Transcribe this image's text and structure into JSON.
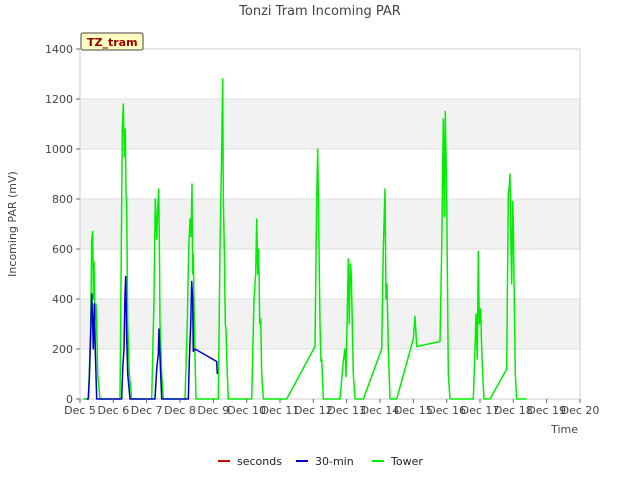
{
  "chart_data": {
    "type": "line",
    "title": "Tonzi Tram Incoming PAR",
    "xlabel": "Time",
    "ylabel": "Incoming PAR (mV)",
    "badge": "TZ_tram",
    "xlim": [
      5,
      20
    ],
    "ylim": [
      0,
      1400
    ],
    "x_ticks": [
      5,
      6,
      7,
      8,
      9,
      10,
      11,
      12,
      13,
      14,
      15,
      16,
      17,
      18,
      19,
      20
    ],
    "x_tick_labels": [
      "Dec 5",
      "Dec 6",
      "Dec 7",
      "Dec 8",
      "Dec 9",
      "Dec 10",
      "Dec 11",
      "Dec 12",
      "Dec 13",
      "Dec 14",
      "Dec 15",
      "Dec 16",
      "Dec 17",
      "Dec 18",
      "Dec 19",
      "Dec 20"
    ],
    "y_ticks": [
      0,
      200,
      400,
      600,
      800,
      1000,
      1200,
      1400
    ],
    "y_tick_labels": [
      "0",
      "200",
      "400",
      "600",
      "800",
      "1000",
      "1200",
      "1400"
    ],
    "grid": true,
    "legend_placement": "bottom",
    "series": [
      {
        "name": "seconds",
        "color": "#cc0000",
        "points": []
      },
      {
        "name": "30-min",
        "color": "#0000cc",
        "points": [
          [
            5.2,
            0
          ],
          [
            5.25,
            0
          ],
          [
            5.28,
            80
          ],
          [
            5.32,
            260
          ],
          [
            5.35,
            420
          ],
          [
            5.38,
            300
          ],
          [
            5.4,
            200
          ],
          [
            5.43,
            380
          ],
          [
            5.46,
            190
          ],
          [
            5.5,
            0
          ],
          [
            5.55,
            0
          ],
          [
            6.2,
            0
          ],
          [
            6.25,
            0
          ],
          [
            6.28,
            120
          ],
          [
            6.32,
            200
          ],
          [
            6.35,
            420
          ],
          [
            6.37,
            490
          ],
          [
            6.4,
            250
          ],
          [
            6.43,
            100
          ],
          [
            6.5,
            0
          ],
          [
            6.55,
            0
          ],
          [
            7.2,
            0
          ],
          [
            7.25,
            0
          ],
          [
            7.3,
            120
          ],
          [
            7.35,
            180
          ],
          [
            7.37,
            280
          ],
          [
            7.39,
            200
          ],
          [
            7.45,
            0
          ],
          [
            7.5,
            0
          ],
          [
            8.2,
            0
          ],
          [
            8.25,
            0
          ],
          [
            8.28,
            150
          ],
          [
            8.32,
            300
          ],
          [
            8.35,
            470
          ],
          [
            8.38,
            400
          ],
          [
            8.4,
            190
          ],
          [
            8.45,
            200
          ],
          [
            9.1,
            150
          ],
          [
            9.12,
            100
          ]
        ]
      },
      {
        "name": "Tower",
        "color": "#00ee00",
        "points": [
          [
            5.1,
            0
          ],
          [
            5.2,
            0
          ],
          [
            5.25,
            0
          ],
          [
            5.28,
            100
          ],
          [
            5.32,
            300
          ],
          [
            5.35,
            640
          ],
          [
            5.38,
            670
          ],
          [
            5.4,
            400
          ],
          [
            5.42,
            550
          ],
          [
            5.45,
            320
          ],
          [
            5.48,
            380
          ],
          [
            5.5,
            300
          ],
          [
            5.53,
            100
          ],
          [
            5.6,
            0
          ],
          [
            6.0,
            0
          ],
          [
            6.15,
            0
          ],
          [
            6.2,
            0
          ],
          [
            6.24,
            600
          ],
          [
            6.27,
            1080
          ],
          [
            6.3,
            1180
          ],
          [
            6.33,
            970
          ],
          [
            6.36,
            1080
          ],
          [
            6.38,
            820
          ],
          [
            6.4,
            780
          ],
          [
            6.43,
            300
          ],
          [
            6.48,
            100
          ],
          [
            6.55,
            0
          ],
          [
            7.0,
            0
          ],
          [
            7.15,
            0
          ],
          [
            7.22,
            400
          ],
          [
            7.26,
            800
          ],
          [
            7.3,
            640
          ],
          [
            7.33,
            760
          ],
          [
            7.36,
            840
          ],
          [
            7.38,
            650
          ],
          [
            7.4,
            300
          ],
          [
            7.45,
            100
          ],
          [
            7.5,
            0
          ],
          [
            8.0,
            0
          ],
          [
            8.15,
            0
          ],
          [
            8.22,
            300
          ],
          [
            8.26,
            600
          ],
          [
            8.3,
            720
          ],
          [
            8.33,
            650
          ],
          [
            8.36,
            860
          ],
          [
            8.38,
            500
          ],
          [
            8.4,
            580
          ],
          [
            8.43,
            300
          ],
          [
            8.48,
            0
          ],
          [
            8.55,
            0
          ],
          [
            9.1,
            0
          ],
          [
            9.15,
            0
          ],
          [
            9.2,
            600
          ],
          [
            9.25,
            1000
          ],
          [
            9.28,
            1280
          ],
          [
            9.3,
            800
          ],
          [
            9.33,
            600
          ],
          [
            9.36,
            300
          ],
          [
            9.38,
            280
          ],
          [
            9.42,
            100
          ],
          [
            9.45,
            0
          ],
          [
            9.6,
            0
          ],
          [
            10.0,
            0
          ],
          [
            10.15,
            0
          ],
          [
            10.22,
            400
          ],
          [
            10.27,
            500
          ],
          [
            10.3,
            720
          ],
          [
            10.33,
            500
          ],
          [
            10.36,
            600
          ],
          [
            10.39,
            300
          ],
          [
            10.42,
            320
          ],
          [
            10.45,
            100
          ],
          [
            10.5,
            0
          ],
          [
            11.0,
            0
          ],
          [
            11.2,
            0
          ],
          [
            12.05,
            210
          ],
          [
            12.1,
            800
          ],
          [
            12.13,
            1000
          ],
          [
            12.16,
            700
          ],
          [
            12.2,
            300
          ],
          [
            12.23,
            150
          ],
          [
            12.25,
            160
          ],
          [
            12.3,
            0
          ],
          [
            12.5,
            0
          ],
          [
            12.8,
            0
          ],
          [
            12.9,
            150
          ],
          [
            12.95,
            200
          ],
          [
            12.98,
            90
          ],
          [
            13.02,
            350
          ],
          [
            13.05,
            560
          ],
          [
            13.08,
            300
          ],
          [
            13.11,
            540
          ],
          [
            13.14,
            500
          ],
          [
            13.17,
            300
          ],
          [
            13.2,
            100
          ],
          [
            13.25,
            0
          ],
          [
            13.4,
            0
          ],
          [
            13.5,
            0
          ],
          [
            14.05,
            200
          ],
          [
            14.1,
            600
          ],
          [
            14.15,
            840
          ],
          [
            14.18,
            400
          ],
          [
            14.21,
            460
          ],
          [
            14.25,
            200
          ],
          [
            14.3,
            0
          ],
          [
            14.5,
            0
          ],
          [
            15.0,
            240
          ],
          [
            15.05,
            330
          ],
          [
            15.1,
            210
          ],
          [
            15.8,
            230
          ],
          [
            15.85,
            600
          ],
          [
            15.9,
            1120
          ],
          [
            15.93,
            730
          ],
          [
            15.96,
            1150
          ],
          [
            16.0,
            800
          ],
          [
            16.05,
            100
          ],
          [
            16.1,
            0
          ],
          [
            16.5,
            0
          ],
          [
            16.8,
            0
          ],
          [
            16.85,
            200
          ],
          [
            16.88,
            340
          ],
          [
            16.92,
            160
          ],
          [
            16.95,
            590
          ],
          [
            16.98,
            300
          ],
          [
            17.02,
            360
          ],
          [
            17.05,
            200
          ],
          [
            17.08,
            100
          ],
          [
            17.12,
            0
          ],
          [
            17.3,
            0
          ],
          [
            17.8,
            120
          ],
          [
            17.85,
            820
          ],
          [
            17.88,
            850
          ],
          [
            17.9,
            900
          ],
          [
            17.93,
            600
          ],
          [
            17.95,
            460
          ],
          [
            17.98,
            790
          ],
          [
            18.0,
            700
          ],
          [
            18.03,
            400
          ],
          [
            18.06,
            100
          ],
          [
            18.1,
            0
          ],
          [
            18.4,
            0
          ]
        ]
      }
    ]
  }
}
